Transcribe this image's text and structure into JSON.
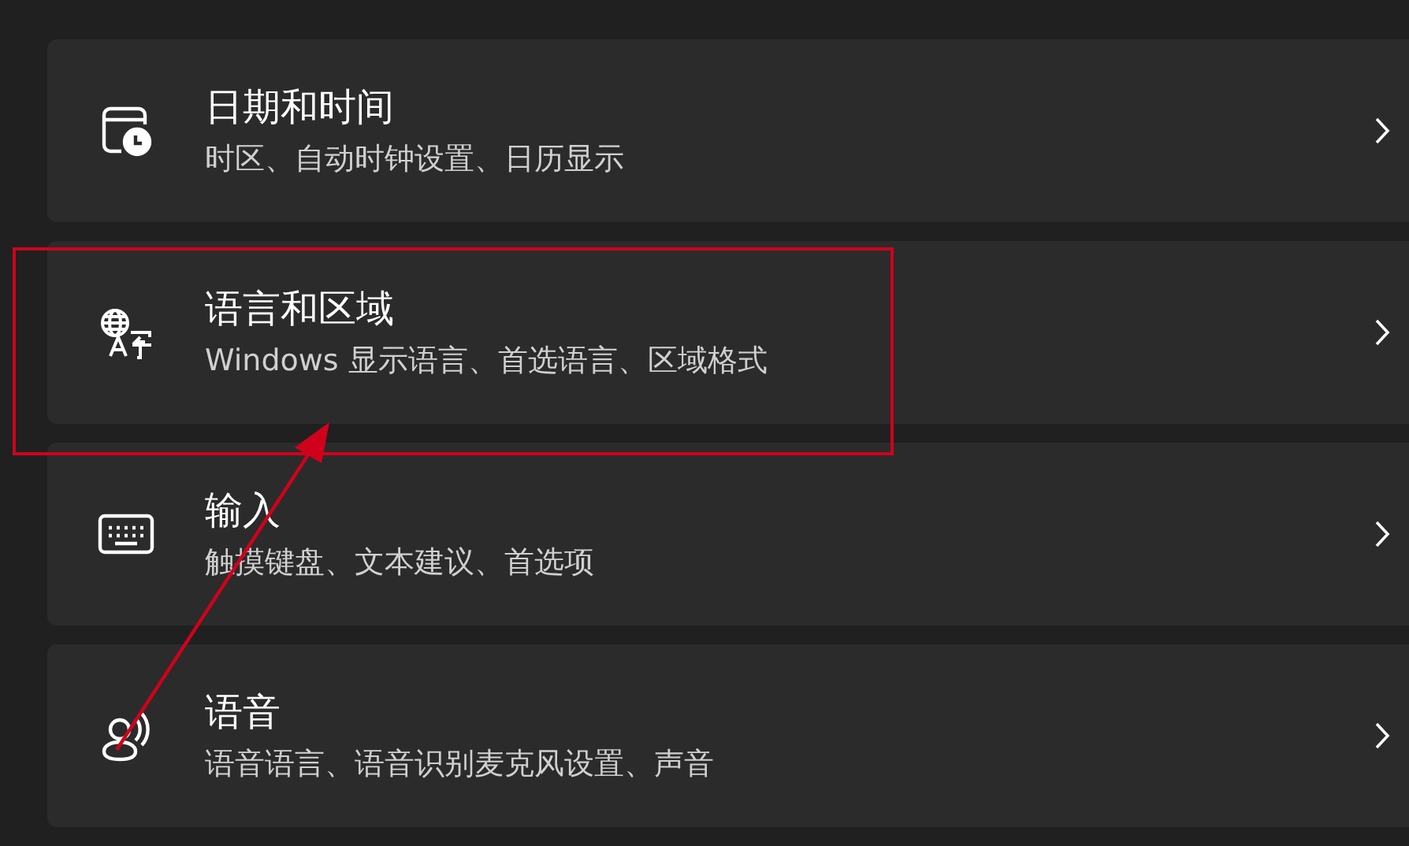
{
  "settings_items": [
    {
      "kind": "clock",
      "title": "日期和时间",
      "subtitle": "时区、自动时钟设置、日历显示"
    },
    {
      "kind": "language",
      "title": "语言和区域",
      "subtitle": "Windows 显示语言、首选语言、区域格式"
    },
    {
      "kind": "keyboard",
      "title": "输入",
      "subtitle": "触摸键盘、文本建议、首选项"
    },
    {
      "kind": "speech",
      "title": "语音",
      "subtitle": "语音语言、语音识别麦克风设置、声音"
    }
  ]
}
